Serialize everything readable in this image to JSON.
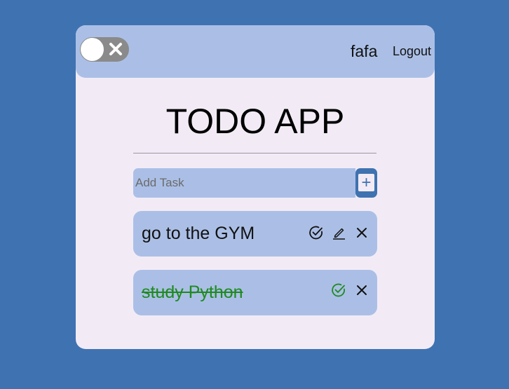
{
  "header": {
    "theme_toggle": {
      "state": "off",
      "icon": "close-icon"
    },
    "username": "fafa",
    "logout_label": "Logout"
  },
  "main": {
    "title": "TODO APP",
    "add_task": {
      "placeholder": "Add Task",
      "value": "",
      "button_label": "+"
    },
    "tasks": [
      {
        "label": "go to the GYM",
        "completed": false,
        "actions": [
          "complete-icon",
          "edit-icon",
          "delete-icon"
        ]
      },
      {
        "label": "study Python",
        "completed": true,
        "actions": [
          "complete-icon",
          "delete-icon"
        ]
      }
    ]
  },
  "colors": {
    "background": "#3f72b0",
    "card": "#f2ebf6",
    "accent": "#abbfe6",
    "toggle": "#8a8a8a",
    "done_text": "#1f8a1f"
  }
}
